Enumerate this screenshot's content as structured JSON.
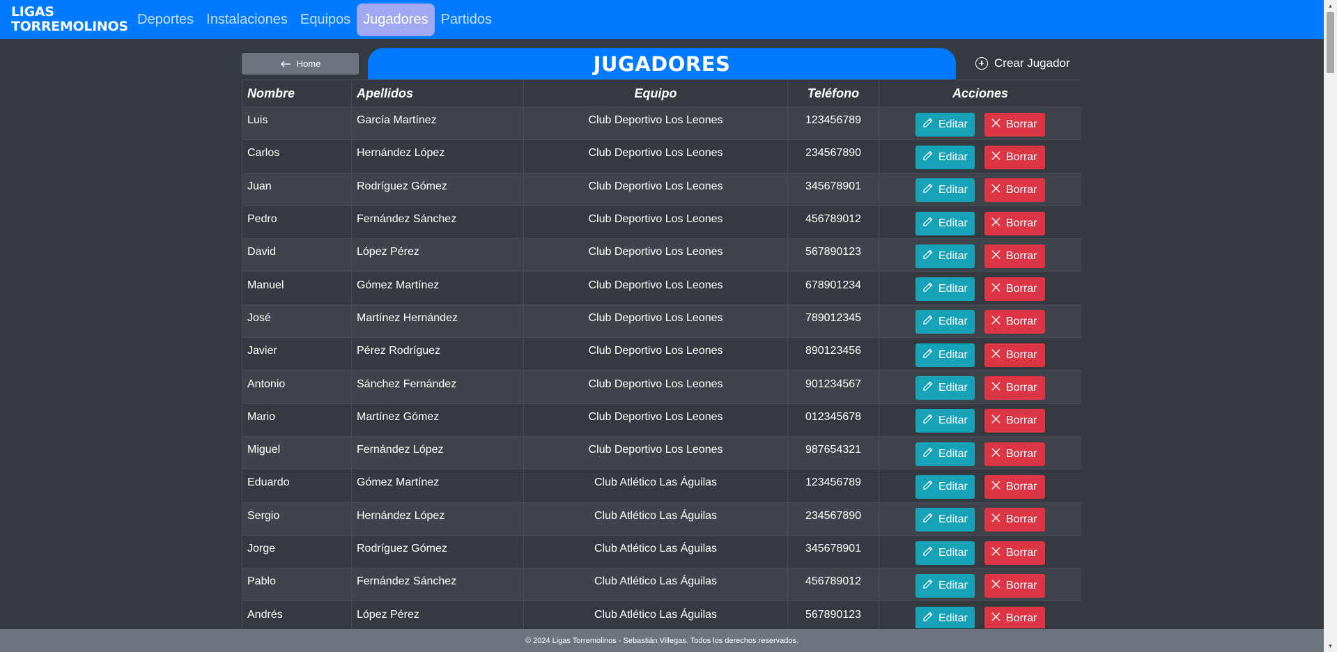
{
  "nav": {
    "brand_line1": "LIGAS",
    "brand_line2": "TORREMOLINOS",
    "items": [
      {
        "label": "Deportes",
        "active": false
      },
      {
        "label": "Instalaciones",
        "active": false
      },
      {
        "label": "Equipos",
        "active": false
      },
      {
        "label": "Jugadores",
        "active": true
      },
      {
        "label": "Partidos",
        "active": false
      }
    ]
  },
  "home_button": "Home",
  "page_title": "JUGADORES",
  "create_button": "Crear Jugador",
  "table": {
    "headers": [
      "Nombre",
      "Apellidos",
      "Equipo",
      "Teléfono",
      "Acciones"
    ],
    "edit_label": "Editar",
    "delete_label": "Borrar",
    "rows": [
      [
        "Luis",
        "García Martínez",
        "Club Deportivo Los Leones",
        "123456789"
      ],
      [
        "Carlos",
        "Hernández López",
        "Club Deportivo Los Leones",
        "234567890"
      ],
      [
        "Juan",
        "Rodríguez Gómez",
        "Club Deportivo Los Leones",
        "345678901"
      ],
      [
        "Pedro",
        "Fernández Sánchez",
        "Club Deportivo Los Leones",
        "456789012"
      ],
      [
        "David",
        "López Pérez",
        "Club Deportivo Los Leones",
        "567890123"
      ],
      [
        "Manuel",
        "Gómez Martínez",
        "Club Deportivo Los Leones",
        "678901234"
      ],
      [
        "José",
        "Martínez Hernández",
        "Club Deportivo Los Leones",
        "789012345"
      ],
      [
        "Javier",
        "Pérez Rodríguez",
        "Club Deportivo Los Leones",
        "890123456"
      ],
      [
        "Antonio",
        "Sánchez Fernández",
        "Club Deportivo Los Leones",
        "901234567"
      ],
      [
        "Mario",
        "Martínez Gómez",
        "Club Deportivo Los Leones",
        "012345678"
      ],
      [
        "Miguel",
        "Fernández López",
        "Club Deportivo Los Leones",
        "987654321"
      ],
      [
        "Eduardo",
        "Gómez Martínez",
        "Club Atlético Las Águilas",
        "123456789"
      ],
      [
        "Sergio",
        "Hernández López",
        "Club Atlético Las Águilas",
        "234567890"
      ],
      [
        "Jorge",
        "Rodríguez Gómez",
        "Club Atlético Las Águilas",
        "345678901"
      ],
      [
        "Pablo",
        "Fernández Sánchez",
        "Club Atlético Las Águilas",
        "456789012"
      ],
      [
        "Andrés",
        "López Pérez",
        "Club Atlético Las Águilas",
        "567890123"
      ]
    ]
  },
  "footer": "© 2024 Ligas Torremolinos - Sebastián Villegas. Todos los derechos reservados.",
  "colors": {
    "primary": "#007bff",
    "background": "#343a40",
    "edit": "#17a2b8",
    "delete": "#dc3545",
    "secondary": "#6c757d",
    "active_nav": "#9fa8f0"
  }
}
